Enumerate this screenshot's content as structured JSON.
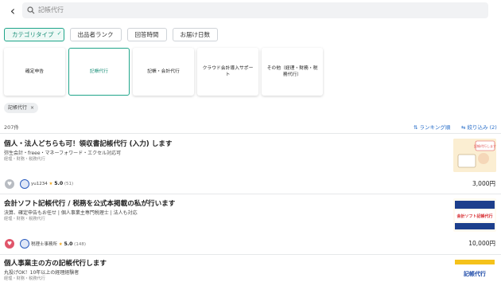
{
  "search": {
    "query": "記帳代行"
  },
  "filters": [
    {
      "label": "カテゴリタイプ",
      "active": true
    },
    {
      "label": "出品者ランク",
      "active": false
    },
    {
      "label": "回答時間",
      "active": false
    },
    {
      "label": "お届け日数",
      "active": false
    }
  ],
  "categories": [
    {
      "label": "確定申告",
      "selected": false
    },
    {
      "label": "記帳代行",
      "selected": true
    },
    {
      "label": "記帳・会計代行",
      "selected": false
    },
    {
      "label": "クラウド会計導入サポート",
      "selected": false
    },
    {
      "label": "その他（経理・財務・税務代行）",
      "selected": false
    }
  ],
  "active_tag": {
    "label": "記帳代行",
    "remove_glyph": "×"
  },
  "results": {
    "count_text": "207件",
    "ranking_label": "⇅ ランキング順",
    "narrow_label": "⇆ 絞り込み (2)"
  },
  "listings": [
    {
      "title": "個人・法人どちらも可！領収書記帳代行 (入力) します",
      "sub": "弥生会計・freee・マネーフォワード・エクセル対応可",
      "meta": "経理・財務・税務代行",
      "seller": "yu1234",
      "rating": "5.0",
      "reviews": "(51)",
      "price": "3,000円",
      "favorited": false,
      "thumb_text": "記帳代行します"
    },
    {
      "title": "会計ソフト記帳代行 / 税務を公式本掲載の私が行います",
      "sub": "決算、確定申告もお任せ | 個人事業主専門税理士 | 法人も対応",
      "meta": "経理・財務・税務代行",
      "seller": "税理士事務所",
      "rating": "5.0",
      "reviews": "(148)",
      "price": "10,000円",
      "favorited": true,
      "thumb_text": "会計ソフト記帳代行"
    },
    {
      "title": "個人事業主の方の記帳代行します",
      "sub": "丸投げOK！10年以上の経理経験者",
      "meta": "経理・財務・税務代行",
      "thumb_text": "記帳代行"
    }
  ],
  "colors": {
    "accent": "#1fa58a",
    "link": "#2a6fc9",
    "star": "#f1a81e",
    "heart_on": "#e0556a"
  }
}
